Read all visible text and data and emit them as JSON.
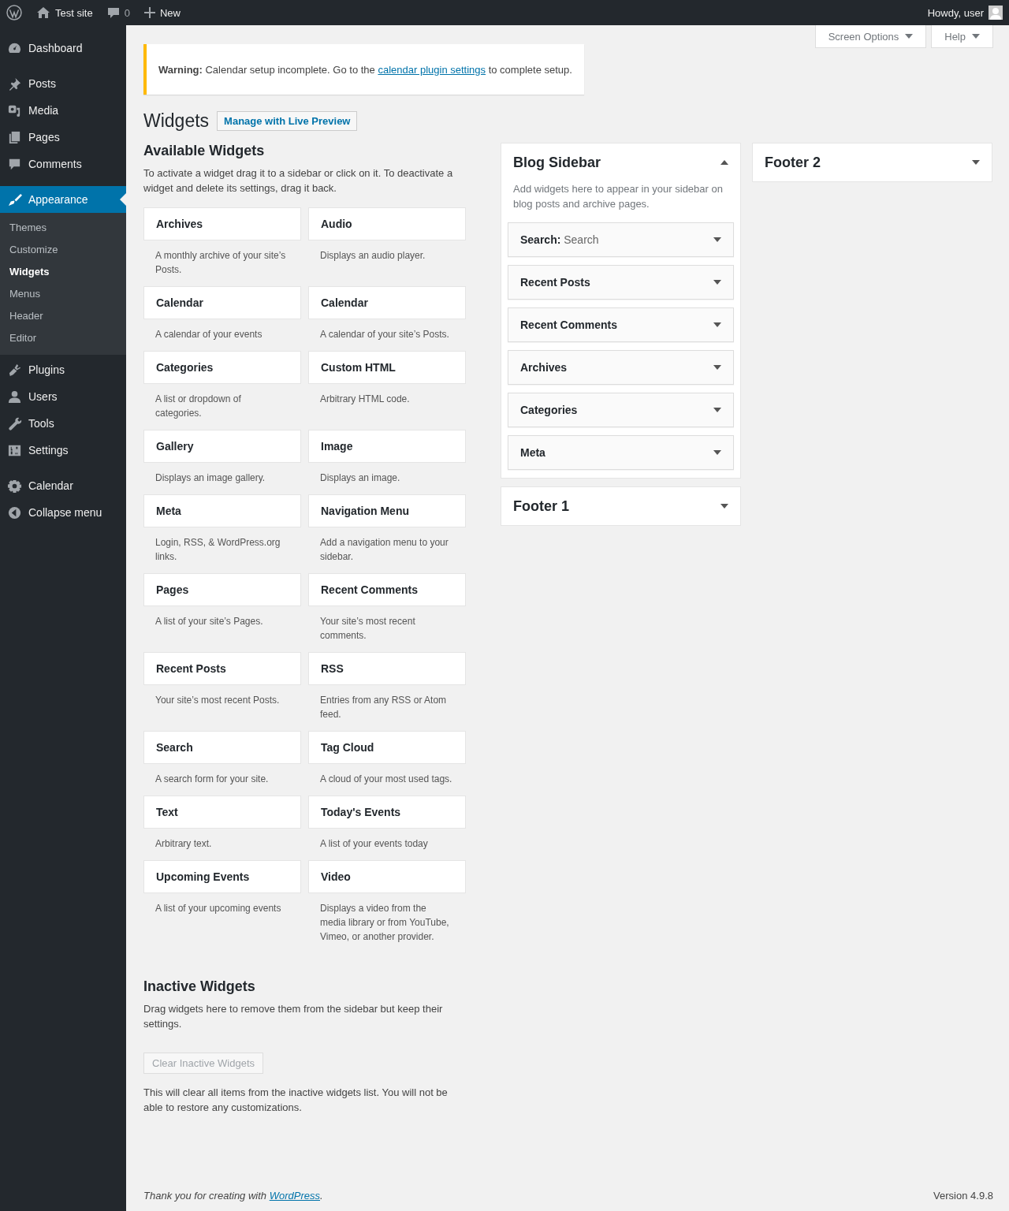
{
  "admin_bar": {
    "site_name": "Test site",
    "comments_count": "0",
    "new_label": "New",
    "greeting": "Howdy, user"
  },
  "menu_groups": [
    {
      "items": [
        {
          "label": "Dashboard",
          "selected": false
        }
      ]
    },
    {
      "items": [
        {
          "label": "Posts",
          "selected": false
        },
        {
          "label": "Media",
          "selected": false
        },
        {
          "label": "Pages",
          "selected": false
        },
        {
          "label": "Comments",
          "selected": false
        }
      ]
    },
    {
      "items": [
        {
          "label": "Appearance",
          "selected": true,
          "children": [
            {
              "label": "Themes",
              "selected": false
            },
            {
              "label": "Customize",
              "selected": false
            },
            {
              "label": "Widgets",
              "selected": true
            },
            {
              "label": "Menus",
              "selected": false
            },
            {
              "label": "Header",
              "selected": false
            },
            {
              "label": "Editor",
              "selected": false
            }
          ]
        },
        {
          "label": "Plugins",
          "selected": false
        },
        {
          "label": "Users",
          "selected": false
        },
        {
          "label": "Tools",
          "selected": false
        },
        {
          "label": "Settings",
          "selected": false
        }
      ]
    },
    {
      "items": [
        {
          "label": "Calendar",
          "selected": false
        },
        {
          "label": "Collapse menu",
          "selected": false
        }
      ]
    }
  ],
  "screen_options": "Screen Options",
  "help": "Help",
  "notice": {
    "text_before": "**Warning:** Calendar setup incomplete. Go to the",
    "link": "calendar plugin settings",
    "text_after": "to complete setup."
  },
  "page_title": "Widgets",
  "live_preview_button": "Manage with Live Preview",
  "available": {
    "title": "Available Widgets",
    "description": "To activate a widget drag it to a sidebar or click on it. To deactivate a widget and delete its settings, drag it back.",
    "widgets": [
      {
        "title": "Archives",
        "description": "A monthly archive of your site’s Posts."
      },
      {
        "title": "Audio",
        "description": "Displays an audio player."
      },
      {
        "title": "Calendar",
        "description": "A calendar of your events"
      },
      {
        "title": "Calendar",
        "description": "A calendar of your site’s Posts."
      },
      {
        "title": "Categories",
        "description": "A list or dropdown of categories."
      },
      {
        "title": "Custom HTML",
        "description": "Arbitrary HTML code."
      },
      {
        "title": "Gallery",
        "description": "Displays an image gallery."
      },
      {
        "title": "Image",
        "description": "Displays an image."
      },
      {
        "title": "Meta",
        "description": "Login, RSS, & WordPress.org links."
      },
      {
        "title": "Navigation Menu",
        "description": "Add a navigation menu to your sidebar."
      },
      {
        "title": "Pages",
        "description": "A list of your site’s Pages."
      },
      {
        "title": "Recent Comments",
        "description": "Your site’s most recent comments."
      },
      {
        "title": "Recent Posts",
        "description": "Your site’s most recent Posts."
      },
      {
        "title": "RSS",
        "description": "Entries from any RSS or Atom feed."
      },
      {
        "title": "Search",
        "description": "A search form for your site."
      },
      {
        "title": "Tag Cloud",
        "description": "A cloud of your most used tags."
      },
      {
        "title": "Text",
        "description": "Arbitrary text."
      },
      {
        "title": "Today's Events",
        "description": "A list of your events today"
      },
      {
        "title": "Upcoming Events",
        "description": "A list of your upcoming events"
      },
      {
        "title": "Video",
        "description": "Displays a video from the media library or from YouTube, Vimeo, or another provider."
      }
    ]
  },
  "inactive": {
    "title": "Inactive Widgets",
    "description": "Drag widgets here to remove them from the sidebar but keep their settings.",
    "clear_button": {
      "label": "Clear Inactive Widgets",
      "disabled": true
    },
    "note": "This will clear all items from the inactive widgets list. You will not be able to restore any customizations."
  },
  "sidebar_columns": [
    {
      "sidebars": [
        {
          "title": "Blog Sidebar",
          "expanded": true,
          "description": "Add widgets here to appear in your sidebar on blog posts and archive pages.",
          "widgets": [
            {
              "title": "Search:",
              "in_title": "Search"
            },
            {
              "title": "Recent Posts"
            },
            {
              "title": "Recent Comments"
            },
            {
              "title": "Archives"
            },
            {
              "title": "Categories"
            },
            {
              "title": "Meta"
            }
          ]
        },
        {
          "title": "Footer 1",
          "expanded": false
        }
      ]
    },
    {
      "sidebars": [
        {
          "title": "Footer 2",
          "expanded": false
        }
      ]
    }
  ],
  "footer": {
    "thanks": "Thank you for creating with",
    "link": "WordPress",
    "period": ".",
    "version": "Version 4.9.8"
  }
}
